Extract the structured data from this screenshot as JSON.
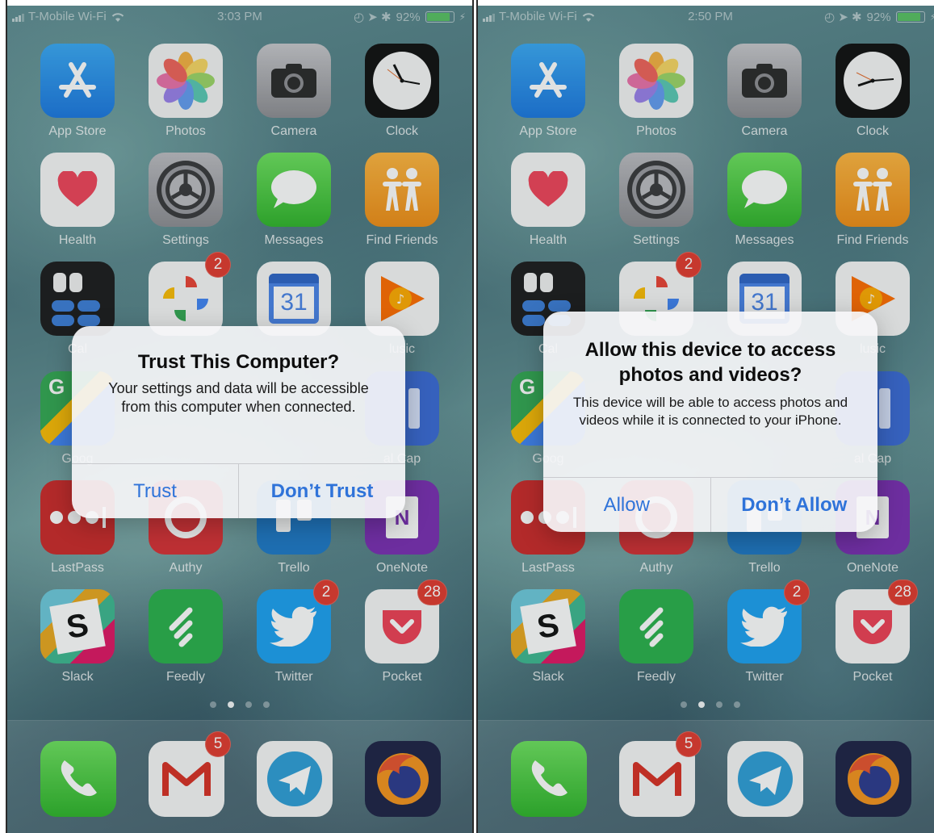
{
  "phones": [
    {
      "status": {
        "carrier": "T-Mobile Wi-Fi",
        "time": "3:03 PM",
        "battery": "92%"
      },
      "alert": {
        "title": "Trust This Computer?",
        "message": "Your settings and data will be accessible from this computer when connected.",
        "buttons": [
          "Trust",
          "Don’t Trust"
        ]
      }
    },
    {
      "status": {
        "carrier": "T-Mobile Wi-Fi",
        "time": "2:50 PM",
        "battery": "92%"
      },
      "alert": {
        "title": "Allow this device to access photos and videos?",
        "message": "This device will be able to access photos and videos while it is connected to your iPhone.",
        "buttons": [
          "Allow",
          "Don’t Allow"
        ]
      }
    }
  ],
  "home": {
    "apps": [
      {
        "label": "App Store",
        "icon": "app-store-icon"
      },
      {
        "label": "Photos",
        "icon": "photos-icon"
      },
      {
        "label": "Camera",
        "icon": "camera-icon"
      },
      {
        "label": "Clock",
        "icon": "clock-icon"
      },
      {
        "label": "Health",
        "icon": "health-icon"
      },
      {
        "label": "Settings",
        "icon": "settings-icon"
      },
      {
        "label": "Messages",
        "icon": "messages-icon"
      },
      {
        "label": "Find Friends",
        "icon": "find-friends-icon"
      },
      {
        "label": "Cal",
        "icon": "calculator-icon"
      },
      {
        "label": "",
        "icon": "google-photos-icon",
        "badge": "2"
      },
      {
        "label": "",
        "icon": "google-calendar-icon",
        "calendar_day": "31"
      },
      {
        "label": "lusic",
        "icon": "google-play-music-icon"
      },
      {
        "label": "Goog",
        "icon": "google-maps-icon"
      },
      {
        "label": "",
        "icon": "hidden-app-icon"
      },
      {
        "label": "",
        "icon": "hidden-app-icon"
      },
      {
        "label": "al Cap",
        "icon": "capture-app-icon"
      },
      {
        "label": "LastPass",
        "icon": "lastpass-icon"
      },
      {
        "label": "Authy",
        "icon": "authy-icon"
      },
      {
        "label": "Trello",
        "icon": "trello-icon"
      },
      {
        "label": "OneNote",
        "icon": "onenote-icon",
        "letter": "N"
      },
      {
        "label": "Slack",
        "icon": "slack-icon",
        "letter": "S"
      },
      {
        "label": "Feedly",
        "icon": "feedly-icon"
      },
      {
        "label": "Twitter",
        "icon": "twitter-icon",
        "badge": "2"
      },
      {
        "label": "Pocket",
        "icon": "pocket-icon",
        "badge": "28"
      }
    ],
    "dock": [
      {
        "icon": "phone-icon"
      },
      {
        "icon": "gmail-icon",
        "badge": "5"
      },
      {
        "icon": "telegram-icon"
      },
      {
        "icon": "firefox-icon"
      }
    ],
    "page_dots": {
      "count": 4,
      "active": 2
    },
    "colors": {
      "badge": "#e23b2f",
      "alert_button": "#2f73d9"
    }
  }
}
